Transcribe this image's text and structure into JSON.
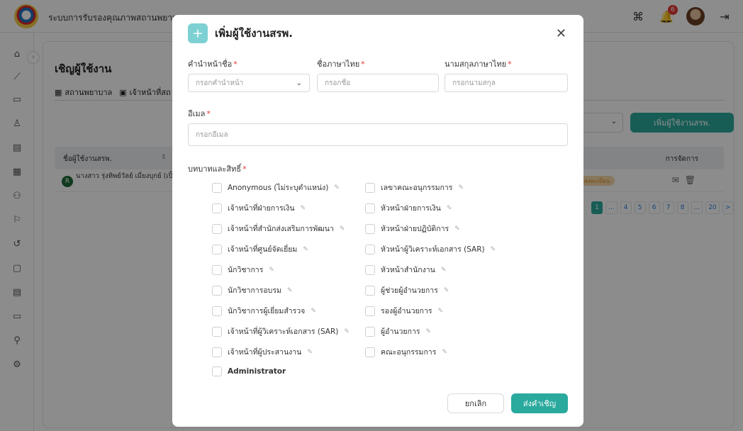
{
  "app": {
    "title": "ระบบการรับรองคุณภาพสถานพยาบ",
    "notification_count": "6"
  },
  "page": {
    "title": "เชิญผู้ใช้งาน",
    "tabs": [
      {
        "label": "สถานพยาบาล"
      },
      {
        "label": "เจ้าหน้าที่สถ"
      }
    ],
    "add_button": "เพิ่มผู้ใช้งานสรพ.",
    "table": {
      "col_user": "ชื่อผู้ใช้งานสรพ.",
      "col_manage": "การจัดการ",
      "rows": [
        {
          "initial": "R",
          "name": "นางสาว รุ่งทิพย์วัลย์ เมี่ยงบุกย์ (เปิ้ล)",
          "status": "ลงทะเบียน"
        }
      ]
    },
    "pagination": [
      "1",
      "...",
      "4",
      "5",
      "6",
      "7",
      "8",
      "...",
      "20",
      ">"
    ]
  },
  "modal": {
    "title": "เพิ่มผู้ใช้งานสรพ.",
    "prefix_label": "คำนำหน้าชื่อ",
    "prefix_placeholder": "กรอกคำนำหน้า",
    "firstname_label": "ชื่อภาษาไทย",
    "firstname_placeholder": "กรอกชื่อ",
    "lastname_label": "นามสกุลภาษาไทย",
    "lastname_placeholder": "กรอกนามสกุล",
    "email_label": "อีเมล",
    "email_placeholder": "กรอกอีเมล",
    "roles_label": "บทบาทและสิทธิ์",
    "required_mark": "*",
    "roles_left": [
      "Anonymous (ไม่ระบุตำแหน่ง)",
      "เจ้าหน้าที่ฝ่ายการเงิน",
      "เจ้าหน้าที่สำนักส่งเสริมการพัฒนา",
      "เจ้าหน้าที่ศูนย์จัดเยี่ยม",
      "นักวิชาการ",
      "นักวิชาการอบรม",
      "นักวิชาการผู้เยี่ยมสำรวจ",
      "เจ้าหน้าที่ผู้วิเคราะห์เอกสาร (SAR)",
      "เจ้าหน้าที่ผู้ประสานงาน",
      "Administrator"
    ],
    "roles_right": [
      "เลขาคณะอนุกรรมการ",
      "หัวหน้าฝ่ายการเงิน",
      "หัวหน้าฝ่ายปฏิบัติการ",
      "หัวหน้าผู้วิเคราะห์เอกสาร (SAR)",
      "หัวหน้าสำนักงาน",
      "ผู้ช่วยผู้อำนวยการ",
      "รองผู้อำนวยการ",
      "ผู้อำนวยการ",
      "คณะอนุกรรมการ"
    ],
    "cancel_label": "ยกเลิก",
    "invite_label": "ส่งคำเชิญ"
  }
}
